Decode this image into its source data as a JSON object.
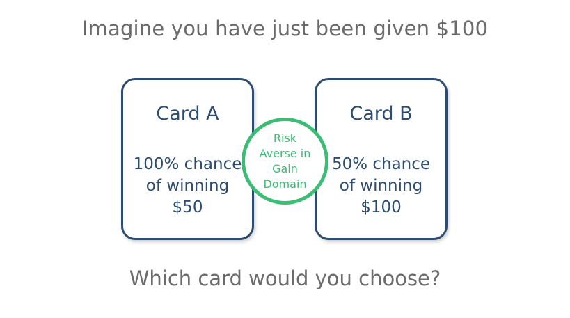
{
  "headline": "Imagine you have just been given $100",
  "cards": [
    {
      "title": "Card A",
      "description": "100% chance\nof winning\n$50"
    },
    {
      "title": "Card B",
      "description": "50% chance\nof winning\n$100"
    }
  ],
  "badge": {
    "text": "Risk\nAverse in\nGain\nDomain"
  },
  "question": "Which card would you choose?",
  "colors": {
    "text_gray": "#6b6b6b",
    "card_blue": "#2c4c73",
    "badge_green": "#3bbd74"
  }
}
